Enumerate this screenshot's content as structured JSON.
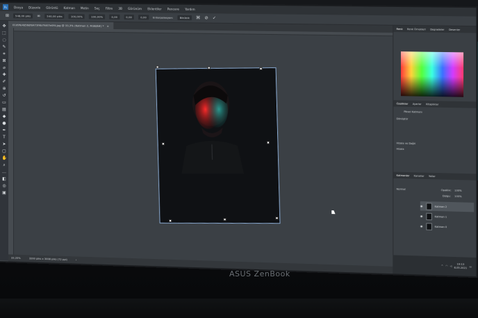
{
  "app": {
    "menu": [
      "Dosya",
      "Düzenle",
      "Görüntü",
      "Katman",
      "Metin",
      "Seç",
      "Filtre",
      "3B",
      "Görünüm",
      "Eklentiler",
      "Pencere",
      "Yardım"
    ],
    "options": {
      "width": "548,00 piks",
      "height": "540,00 piks",
      "scale_w": "100,00%",
      "scale_h": "100,00%",
      "angle": "0,00",
      "h_skew": "0,00",
      "v_skew": "0,00",
      "interp_label": "Enterpolasyon:",
      "interp_value": "Bikübik"
    },
    "document_tab": "01d9fe4b56dfd473f4b7fd07e0f4.jpg @ 33,3% (Katman 2, RGB/8#) *",
    "status": {
      "zoom": "33,33%",
      "doc_size": "3200 piks x 3008 piks (72 ppi)"
    },
    "panels": {
      "top_tabs": [
        "Renk",
        "Renk Örnekleri",
        "Degradeler",
        "Desenler"
      ],
      "properties_tabs": [
        "Özellikler",
        "Ayarlar",
        "Kitaplıklar"
      ],
      "properties_subtitle": "Piksel Katmanı",
      "transform_label": "Dönüştür",
      "align_label": "Hizala ve Dağıt",
      "align_sub": "Hizala",
      "layers_tabs": [
        "Katmanlar",
        "Kanallar",
        "Yollar"
      ],
      "blend_mode": "Normal",
      "opacity_label": "Opaklık:",
      "opacity_value": "100%",
      "fill_label": "Dolgu:",
      "fill_value": "100%",
      "layers": [
        {
          "name": "Katman 2",
          "selected": true
        },
        {
          "name": "Katman 1",
          "selected": false
        },
        {
          "name": "Katman 0",
          "selected": false
        }
      ]
    },
    "taskbar": {
      "time": "19:13",
      "date": "8.05.2021"
    }
  },
  "device": {
    "brand": "ASUS ZenBook"
  },
  "colors": {
    "accent": "#2a6fb3",
    "panel_bg": "#3a3f44",
    "canvas_bg": "#3b4045"
  }
}
